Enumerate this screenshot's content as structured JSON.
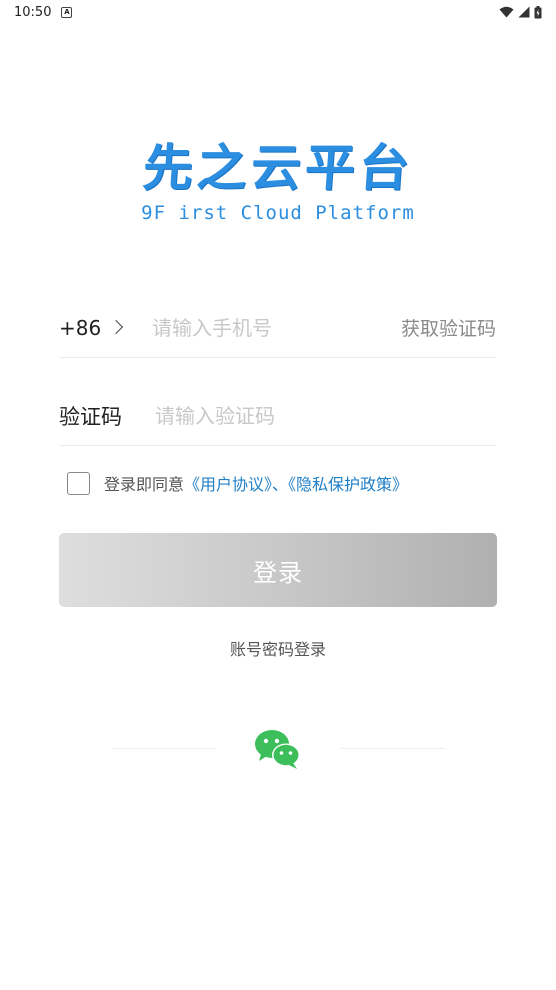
{
  "status_bar": {
    "time": "10:50",
    "app_icon": "A"
  },
  "logo": {
    "title": "先之云平台",
    "subtitle": "9F irst Cloud Platform"
  },
  "phone_row": {
    "country_code": "+86",
    "placeholder": "请输入手机号",
    "get_code_label": "获取验证码"
  },
  "code_row": {
    "label": "验证码",
    "placeholder": "请输入验证码"
  },
  "agreement": {
    "prefix": "登录即同意",
    "user_agreement": "《用户协议》",
    "separator": "、",
    "privacy_policy": "《隐私保护政策》",
    "checked": false
  },
  "login_button": {
    "label": "登录"
  },
  "alt_login": {
    "label": "账号密码登录"
  },
  "icons": {
    "wechat": "wechat-icon",
    "chevron": "chevron-right-icon",
    "wifi": "wifi-icon",
    "signal": "signal-icon",
    "battery": "battery-icon"
  },
  "colors": {
    "brand_blue": "#2c8ee0",
    "link": "#1f7fc7",
    "wechat_green": "#3cbf5a"
  }
}
